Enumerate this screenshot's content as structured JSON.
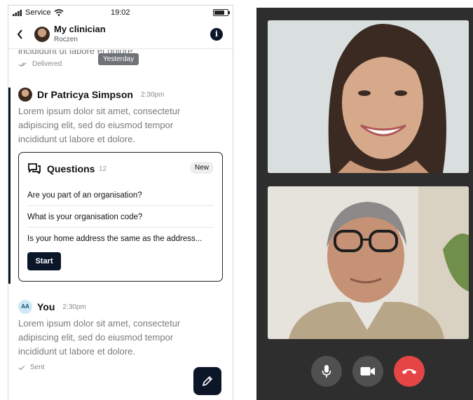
{
  "status_bar": {
    "carrier": "Service",
    "time": "19:02"
  },
  "header": {
    "title": "My clinician",
    "subtitle": "Roczen",
    "info_icon": "i"
  },
  "previous_message": {
    "cut_text": "incididunt ut labore et dolore.",
    "status": "Delivered"
  },
  "date_chip": "Yesterday",
  "doctor_message": {
    "name": "Dr Patricya Simpson",
    "time": "2:30pm",
    "body": "Lorem ipsum dolor sit amet, consectetur adipiscing elit, sed do eiusmod tempor incididunt ut labore et dolore."
  },
  "questions_card": {
    "title": "Questions",
    "count": "12",
    "badge": "New",
    "items": [
      "Are you part of an organisation?",
      "What is your organisation code?",
      "Is your home address the same as the address..."
    ],
    "start_label": "Start"
  },
  "you_message": {
    "initials": "AA",
    "name": "You",
    "time": "2:30pm",
    "body": "Lorem ipsum dolor sit amet, consectetur adipiscing elit, sed do eiusmod tempor incididunt ut labore et dolore.",
    "status": "Sent"
  },
  "call_controls": {
    "mic": "microphone-icon",
    "camera": "video-camera-icon",
    "end": "end-call-icon",
    "end_color": "#e54545"
  },
  "colors": {
    "primary": "#0b1628",
    "call_background": "#2e2e2e"
  }
}
